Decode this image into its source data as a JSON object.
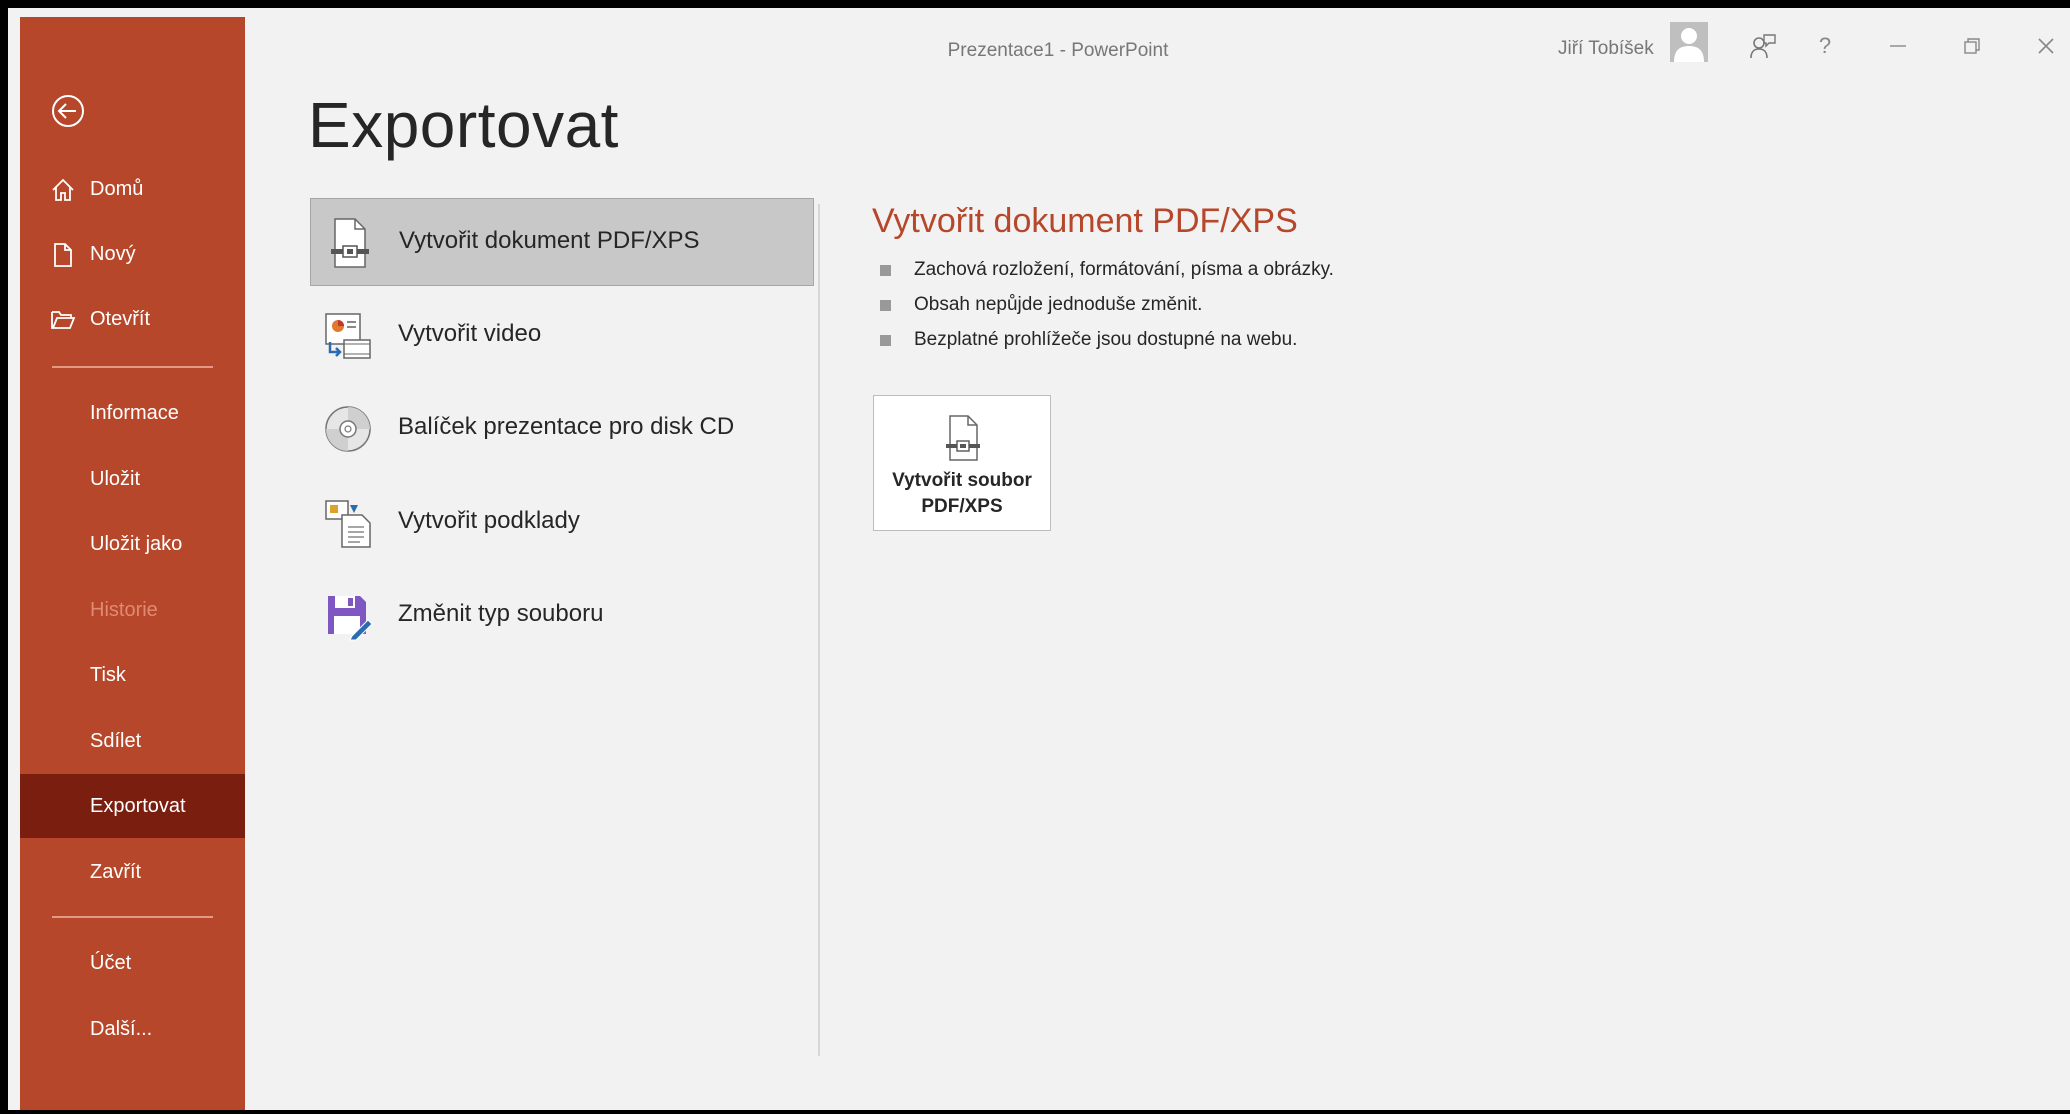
{
  "titlebar": {
    "document_title": "Prezentace1  -  PowerPoint",
    "user_name": "Jiří Tobíšek",
    "help_label": "?"
  },
  "sidebar": {
    "items": [
      {
        "label": "Domů",
        "icon": "home-icon"
      },
      {
        "label": "Nový",
        "icon": "new-document-icon"
      },
      {
        "label": "Otevřít",
        "icon": "open-folder-icon"
      },
      {
        "label": "Informace"
      },
      {
        "label": "Uložit"
      },
      {
        "label": "Uložit jako"
      },
      {
        "label": "Historie",
        "state": "disabled"
      },
      {
        "label": "Tisk"
      },
      {
        "label": "Sdílet"
      },
      {
        "label": "Exportovat",
        "state": "active"
      },
      {
        "label": "Zavřít"
      },
      {
        "label": "Účet"
      },
      {
        "label": "Další..."
      }
    ]
  },
  "main": {
    "title": "Exportovat",
    "options": [
      {
        "label": "Vytvořit dokument PDF/XPS",
        "icon": "pdf-document-icon",
        "selected": true
      },
      {
        "label": "Vytvořit video",
        "icon": "video-icon"
      },
      {
        "label": "Balíček prezentace pro disk CD",
        "icon": "cd-icon"
      },
      {
        "label": "Vytvořit podklady",
        "icon": "handouts-icon"
      },
      {
        "label": "Změnit typ souboru",
        "icon": "change-file-type-icon"
      }
    ]
  },
  "detail": {
    "heading": "Vytvořit dokument PDF/XPS",
    "bullets": [
      "Zachová rozložení, formátování, písma a obrázky.",
      "Obsah nepůjde jednoduše změnit.",
      "Bezplatné prohlížeče jsou dostupné na webu."
    ],
    "button_label": "Vytvořit soubor\nPDF/XPS"
  },
  "colors": {
    "accent": "#b7472a",
    "active_item": "#7a1e10",
    "background": "#f2f2f2"
  }
}
